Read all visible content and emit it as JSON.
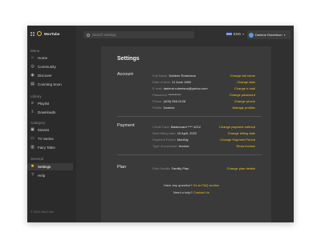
{
  "app": {
    "name": "MovTube"
  },
  "sidebar": {
    "menu_title": "Menu",
    "menu": [
      {
        "label": "Home",
        "icon": "home-icon",
        "glyph": "⌂"
      },
      {
        "label": "Community",
        "icon": "community-icon",
        "glyph": "◎"
      },
      {
        "label": "Discover",
        "icon": "discover-icon",
        "glyph": "◉"
      },
      {
        "label": "Cooming Soon",
        "icon": "calendar-icon",
        "glyph": "▤"
      }
    ],
    "library_title": "Library",
    "library": [
      {
        "label": "Playlist",
        "icon": "playlist-icon",
        "glyph": "≡"
      },
      {
        "label": "Downloads",
        "icon": "download-icon",
        "glyph": "⇩"
      }
    ],
    "category_title": "Category",
    "category": [
      {
        "label": "Movies",
        "icon": "movie-icon",
        "glyph": "▣"
      },
      {
        "label": "TV Series",
        "icon": "tv-icon",
        "glyph": "▭"
      },
      {
        "label": "Fairy Tales",
        "icon": "book-icon",
        "glyph": "▥"
      }
    ],
    "general_title": "General",
    "general": [
      {
        "label": "Settings",
        "icon": "gear-icon",
        "glyph": "✹",
        "active": true
      },
      {
        "label": "Help",
        "icon": "help-icon",
        "glyph": "?"
      }
    ],
    "copyright": "© 2022 MovTube"
  },
  "topbar": {
    "search_placeholder": "Search settings",
    "language": "ENG",
    "user_name": "Darlene Robertson"
  },
  "settings": {
    "title": "Settings",
    "account": {
      "title": "Account",
      "rows": [
        {
          "label": "Full Name:",
          "value": "Darlene Robertson",
          "action": "Change full name"
        },
        {
          "label": "Date of birth:",
          "value": "11 June 1980",
          "action": "Change date"
        },
        {
          "label": "E-mail:",
          "value": "darlene.robertson@yahoo.com",
          "action": "Change e-mail"
        },
        {
          "label": "Password:",
          "value": "**********",
          "action": "Change password"
        },
        {
          "label": "Phone:",
          "value": "(405) 555-0128",
          "action": "Change phone"
        },
        {
          "label": "Profile:",
          "value": "Darlene",
          "action": "Manage profiles"
        }
      ]
    },
    "payment": {
      "title": "Payment",
      "rows": [
        {
          "label": "Credit Card:",
          "value": "Mastercard **** 4212",
          "action": "Change payment method"
        },
        {
          "label": "Next billing date:",
          "value": "15 April, 2022",
          "action": "Change billing date"
        },
        {
          "label": "Payment Period:",
          "value": "Monthly",
          "action": "Change Payment Period"
        },
        {
          "label": "Type of purchase:",
          "value": "Invoice",
          "action": "Show invoice"
        }
      ]
    },
    "plan": {
      "title": "Plan",
      "rows": [
        {
          "label": "Plan Details:",
          "value": "Familly Plan",
          "action": "Change plan details"
        }
      ]
    },
    "faq": {
      "text": "Have any question?",
      "link": "Go to FAQ section"
    },
    "help": {
      "text": "Need a help?",
      "link": "Contact Us"
    }
  },
  "colors": {
    "accent": "#f2c21b",
    "background": "#303030",
    "panel": "#3a3a3a",
    "sidebar": "#2b2b2b"
  }
}
